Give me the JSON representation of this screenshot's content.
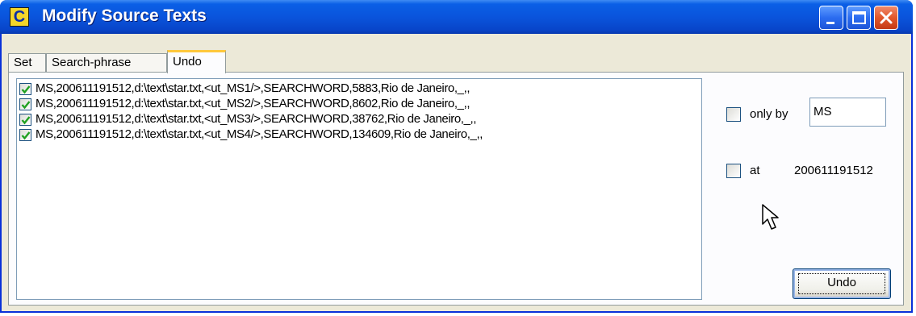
{
  "window": {
    "title": "Modify Source Texts",
    "app_icon_letter": "C"
  },
  "tabs": [
    {
      "label": "Set"
    },
    {
      "label": "Search-phrase"
    },
    {
      "label": "Undo",
      "selected": true
    }
  ],
  "undo_list": {
    "items": [
      {
        "checked": true,
        "text": "MS,200611191512,d:\\text\\star.txt,<ut_MS1/>,SEARCHWORD,5883,Rio de Janeiro,_,,"
      },
      {
        "checked": true,
        "text": "MS,200611191512,d:\\text\\star.txt,<ut_MS2/>,SEARCHWORD,8602,Rio de Janeiro,_,,"
      },
      {
        "checked": true,
        "text": "MS,200611191512,d:\\text\\star.txt,<ut_MS3/>,SEARCHWORD,38762,Rio de Janeiro,_,,"
      },
      {
        "checked": true,
        "text": "MS,200611191512,d:\\text\\star.txt,<ut_MS4/>,SEARCHWORD,134609,Rio de Janeiro,_,,"
      }
    ]
  },
  "filters": {
    "only_by_label": "only by",
    "only_by_checked": false,
    "only_by_value": "MS",
    "at_label": "at",
    "at_checked": false,
    "at_value": "200611191512"
  },
  "actions": {
    "undo_label": "Undo"
  },
  "colors": {
    "titlebar": "#0a54dc",
    "window_face": "#ece9d8",
    "checkmark": "#21a121",
    "selected_tab_accent": "#ffc83c"
  }
}
